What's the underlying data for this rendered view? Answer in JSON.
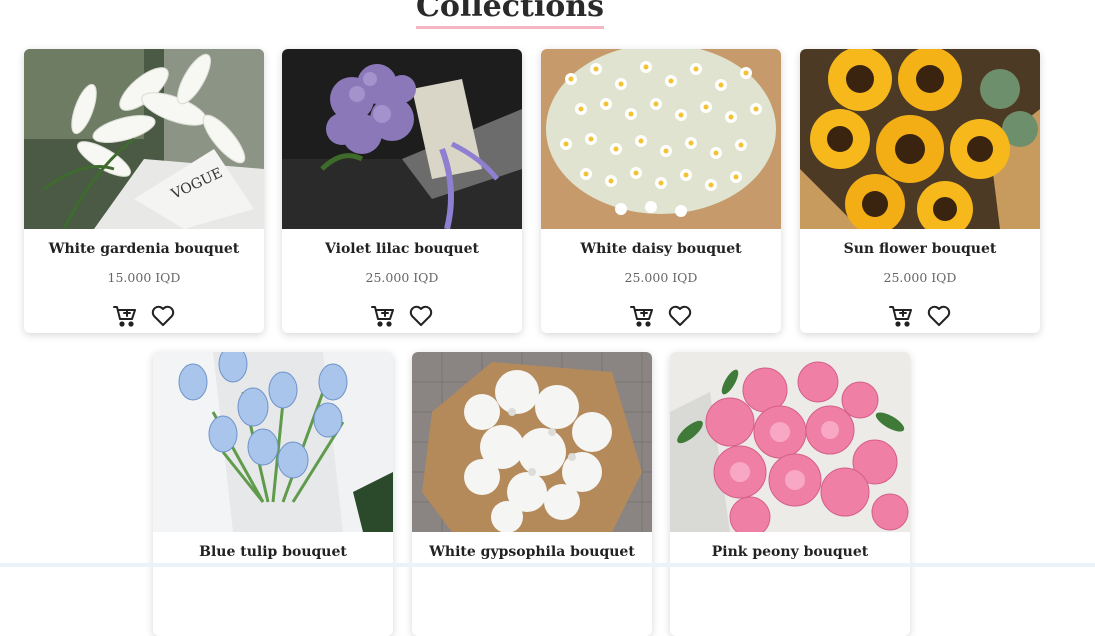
{
  "page": {
    "title": "Collections"
  },
  "products": [
    {
      "name": "White gardenia bouquet",
      "price": "15.000 IQD",
      "image": "white-gardenia-photo"
    },
    {
      "name": "Violet lilac bouquet",
      "price": "25.000 IQD",
      "image": "violet-lilac-photo"
    },
    {
      "name": "White daisy bouquet",
      "price": "25.000 IQD",
      "image": "white-daisy-photo"
    },
    {
      "name": "Sun flower bouquet",
      "price": "25.000 IQD",
      "image": "sunflower-photo"
    },
    {
      "name": "Blue tulip bouquet",
      "price": "",
      "image": "blue-tulip-photo"
    },
    {
      "name": "White gypsophila bouquet",
      "price": "",
      "image": "white-gypsophila-photo"
    },
    {
      "name": "Pink peony bouquet",
      "price": "",
      "image": "pink-peony-photo"
    }
  ],
  "icons": {
    "cart": "cart-icon",
    "favorite": "heart-icon"
  },
  "colors": {
    "title_underline": "#f3b6c2",
    "text": "#222222",
    "price": "#666666"
  }
}
